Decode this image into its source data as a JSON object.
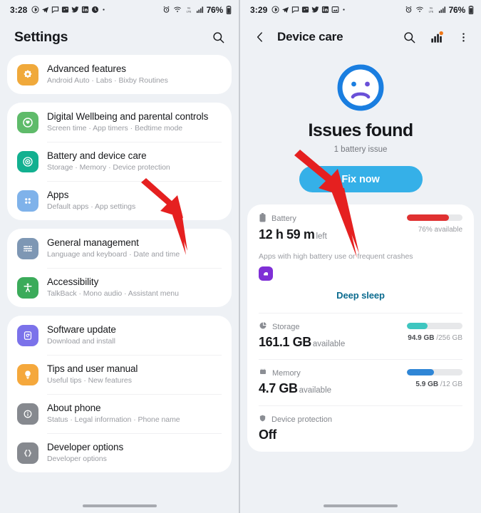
{
  "colors": {
    "accent_blue": "#35b0e8",
    "deep_sleep_link": "#0b6b8f",
    "battery_bar": "#e03131",
    "storage_bar": "#3ec6c0",
    "memory_bar": "#2f86d6",
    "arrow_red": "#e52020",
    "page_bg": "#eef1f5",
    "card_bg": "#ffffff"
  },
  "left_panel": {
    "status_bar": {
      "time": "3:28",
      "battery_percent": "76%",
      "left_icons": [
        "circle-d-icon",
        "telegram-icon",
        "chat-icon",
        "camera-app-icon",
        "twitter-icon",
        "linkedin-icon",
        "clock-app-icon",
        "more-dot-icon"
      ],
      "right_icons": [
        "alarm-icon",
        "wifi-calling-icon",
        "volte-icon",
        "signal-icon",
        "battery-icon"
      ]
    },
    "header": {
      "title": "Settings",
      "search_icon": "search-icon"
    },
    "groups": [
      {
        "items": [
          {
            "icon": "advanced-features-icon",
            "icon_color": "#f0a93b",
            "title": "Advanced features",
            "subtitle": "Android Auto  ·  Labs  ·  Bixby Routines"
          }
        ]
      },
      {
        "items": [
          {
            "icon": "digital-wellbeing-icon",
            "icon_color": "#5fbb6a",
            "title": "Digital Wellbeing and parental controls",
            "subtitle": "Screen time  ·  App timers  ·  Bedtime mode"
          },
          {
            "icon": "battery-device-care-icon",
            "icon_color": "#12b090",
            "title": "Battery and device care",
            "subtitle": "Storage  ·  Memory  ·  Device protection"
          },
          {
            "icon": "apps-icon",
            "icon_color": "#7fb2ea",
            "title": "Apps",
            "subtitle": "Default apps  ·  App settings"
          }
        ]
      },
      {
        "items": [
          {
            "icon": "general-management-icon",
            "icon_color": "#7e97b4",
            "title": "General management",
            "subtitle": "Language and keyboard  ·  Date and time"
          },
          {
            "icon": "accessibility-icon",
            "icon_color": "#3bab5a",
            "title": "Accessibility",
            "subtitle": "TalkBack  ·  Mono audio  ·  Assistant menu"
          }
        ]
      },
      {
        "items": [
          {
            "icon": "software-update-icon",
            "icon_color": "#7b72ea",
            "title": "Software update",
            "subtitle": "Download and install"
          },
          {
            "icon": "tips-manual-icon",
            "icon_color": "#f5a83c",
            "title": "Tips and user manual",
            "subtitle": "Useful tips  ·  New features"
          },
          {
            "icon": "about-phone-icon",
            "icon_color": "#86898f",
            "title": "About phone",
            "subtitle": "Status  ·  Legal information  ·  Phone name"
          },
          {
            "icon": "developer-options-icon",
            "icon_color": "#86898f",
            "title": "Developer options",
            "subtitle": "Developer options"
          }
        ]
      }
    ]
  },
  "right_panel": {
    "status_bar": {
      "time": "3:29",
      "battery_percent": "76%",
      "left_icons": [
        "circle-d-icon",
        "telegram-icon",
        "chat-icon",
        "camera-app-icon",
        "twitter-icon",
        "linkedin-icon",
        "gallery-app-icon",
        "more-dot-icon"
      ],
      "right_icons": [
        "alarm-icon",
        "wifi-calling-icon",
        "volte-icon",
        "signal-icon",
        "battery-icon"
      ]
    },
    "header": {
      "back_icon": "back-chevron-icon",
      "title": "Device care",
      "search_icon": "search-icon",
      "stats_icon": "bar-chart-icon",
      "stats_badge": true,
      "overflow_icon": "more-vertical-icon"
    },
    "hero": {
      "face_icon": "sad-face-icon",
      "title": "Issues found",
      "subtitle": "1 battery issue",
      "button_label": "Fix now"
    },
    "battery": {
      "icon": "battery-icon",
      "label": "Battery",
      "value": "12 h 59 m",
      "unit": "left",
      "gauge_text": "76% available",
      "gauge_percent": 76,
      "apps_note": "Apps with high battery use or frequent crashes",
      "app_icon": "purple-app-icon",
      "deep_sleep_label": "Deep sleep"
    },
    "storage": {
      "icon": "storage-icon",
      "label": "Storage",
      "value": "161.1 GB",
      "unit": "available",
      "used": "94.9 GB",
      "total": "/256 GB",
      "gauge_percent": 37
    },
    "memory": {
      "icon": "memory-icon",
      "label": "Memory",
      "value": "4.7 GB",
      "unit": "available",
      "used": "5.9 GB",
      "total": "/12 GB",
      "gauge_percent": 49
    },
    "device_protection": {
      "icon": "shield-icon",
      "label": "Device protection",
      "value": "Off"
    }
  }
}
